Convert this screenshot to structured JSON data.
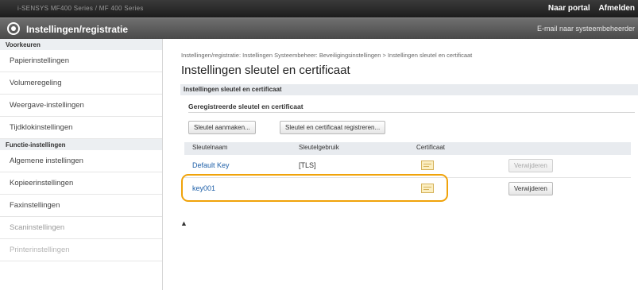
{
  "topbar": {
    "model": "i-SENSYS MF400 Series / MF 400 Series",
    "links": [
      "Naar portal",
      "Afmelden"
    ]
  },
  "titlebar": {
    "title": "Instellingen/registratie",
    "mail_link": "E-mail naar systeembeheerder"
  },
  "sidebar": {
    "section_preferences": "Voorkeuren",
    "preferences": [
      "Papierinstellingen",
      "Volumeregeling",
      "Weergave-instellingen",
      "Tijdklokinstellingen"
    ],
    "section_functions": "Functie-instellingen",
    "functions": [
      "Algemene instellingen",
      "Kopieerinstellingen",
      "Faxinstellingen",
      "Scaninstellingen",
      "Printerinstellingen"
    ]
  },
  "main": {
    "breadcrumb": "Instellingen/registratie: Instellingen Systeembeheer: Beveiligingsinstellingen > Instellingen sleutel en certificaat",
    "title": "Instellingen sleutel en certificaat",
    "section_header": "Instellingen sleutel en certificaat",
    "subsection_title": "Geregistreerde sleutel en certificaat",
    "buttons": {
      "generate_key": "Sleutel aanmaken...",
      "register_key": "Sleutel en certificaat registreren..."
    },
    "table": {
      "columns": [
        "Sleutelnaam",
        "Sleutelgebruik",
        "Certificaat"
      ],
      "rows": [
        {
          "name": "Default Key",
          "usage": "[TLS]",
          "certificate_icon": "certificate-icon",
          "action": "Verwijderen",
          "action_enabled": false
        },
        {
          "name": "key001",
          "usage": "",
          "certificate_icon": "certificate-icon",
          "action": "Verwijderen",
          "action_enabled": true
        }
      ]
    },
    "top_icon": "▲"
  },
  "colors": {
    "highlight": "#f0a30a",
    "link": "#1d5fa8",
    "topbar": "#2a2a2a",
    "titlebar": "#5a5a5a"
  }
}
